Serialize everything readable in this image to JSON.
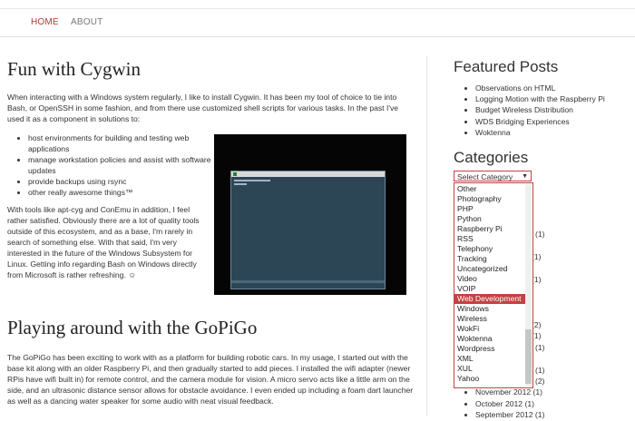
{
  "nav": {
    "home": "HOME",
    "about": "ABOUT"
  },
  "posts": [
    {
      "title": "Fun with Cygwin",
      "intro": "When interacting with a Windows system regularly, I like to install Cygwin. It has been my tool of choice to tie into Bash, or OpenSSH in some fashion, and from there use customized shell scripts for various tasks. In the past I've used it as a component in solutions to:",
      "bullets": [
        "host environments for building and testing web applications",
        "manage workstation policies and assist with software updates",
        "provide backups using rsync",
        "other really awesome things™"
      ],
      "after": "With tools like apt-cyg and ConEmu in addition, I feel rather satisfied. Obviously there are a lot of quality tools outside of this ecosystem, and as a base, I'm rarely in search of something else. With that said, I'm very interested in the future of the Windows Subsystem for Linux. Getting info regarding Bash on Windows directly from Microsoft is rather refreshing. ☺"
    },
    {
      "title": "Playing around with the GoPiGo",
      "body": "The GoPiGo has been exciting to work with as a platform for building robotic cars. In my usage, I started out with the base kit along with an older Raspberry Pi, and then gradually started to add pieces. I installed the wifi adapter (newer RPis have wifi built in) for remote control, and the camera module for vision. A micro servo acts like a little arm on the side, and an ultrasonic distance sensor allows for obstacle avoidance. I even ended up including a foam dart launcher as well as a dancing water speaker for some audio with neat visual feedback."
    }
  ],
  "sidebar": {
    "featured_title": "Featured Posts",
    "featured": [
      "Observations on HTML",
      "Logging Motion with the Raspberry Pi",
      "Budget Wireless Distribution",
      "WDS Bridging Experiences",
      "Woktenna"
    ],
    "categories_title": "Categories",
    "select_value": "Select Category",
    "options": [
      "Other",
      "Photography",
      "PHP",
      "Python",
      "Raspberry Pi",
      "RSS",
      "Telephony",
      "Tracking",
      "Uncategorized",
      "Video",
      "VOIP",
      "Web Development",
      "Windows",
      "Wireless",
      "WokFi",
      "Woktenna",
      "Wordpress",
      "XML",
      "XUL",
      "Yahoo"
    ],
    "selected_option": "Web Development",
    "visible_counts": [
      "(1)",
      "(1)",
      "(1)",
      "(2)",
      "(1)",
      "(1)",
      "(1)",
      "(2)"
    ],
    "archives": [
      "November 2012 (1)",
      "October 2012 (1)",
      "September 2012 (1)"
    ]
  }
}
